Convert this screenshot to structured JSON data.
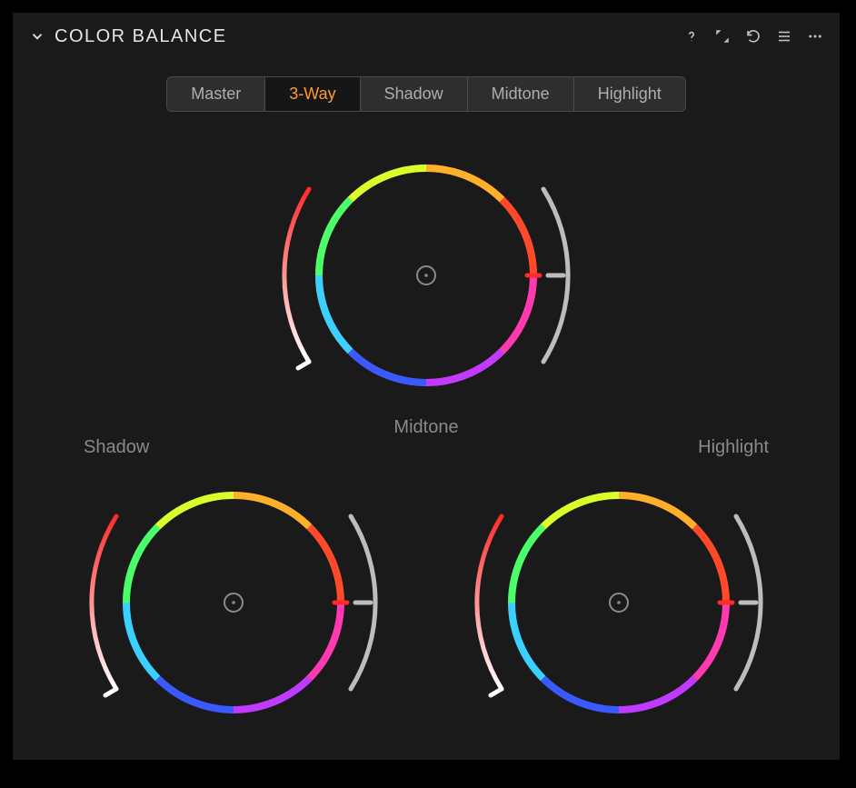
{
  "header": {
    "title": "COLOR BALANCE"
  },
  "tabs": {
    "items": [
      {
        "label": "Master",
        "active": false
      },
      {
        "label": "3-Way",
        "active": true
      },
      {
        "label": "Shadow",
        "active": false
      },
      {
        "label": "Midtone",
        "active": false
      },
      {
        "label": "Highlight",
        "active": false
      }
    ]
  },
  "wheels": {
    "midtone": {
      "label": "Midtone"
    },
    "shadow": {
      "label": "Shadow"
    },
    "highlight": {
      "label": "Highlight"
    }
  },
  "icons": {
    "help": "help-icon",
    "expand": "expand-icon",
    "reset": "reset-icon",
    "menu": "menu-icon",
    "more": "more-icon"
  }
}
